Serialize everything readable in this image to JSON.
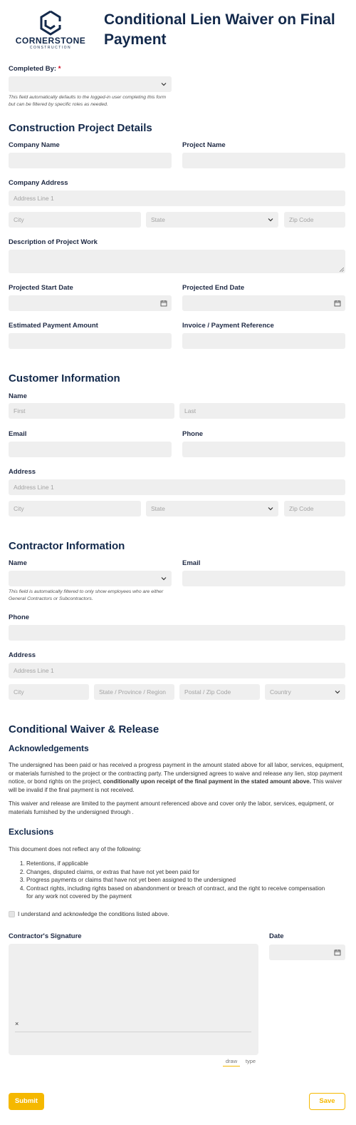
{
  "header": {
    "logo_name": "CORNERSTONE",
    "logo_sub": "CONSTRUCTION",
    "title_line1": "Conditional Lien Waiver on Final",
    "title_line2": "Payment"
  },
  "completed_by": {
    "label": "Completed By:",
    "required_mark": "*",
    "help": "This field automatically defaults to the logged-in user completing this form but can be filtered by specific roles as needed."
  },
  "project": {
    "heading": "Construction Project Details",
    "company_name_label": "Company Name",
    "project_name_label": "Project Name",
    "company_address_label": "Company Address",
    "address_line1_ph": "Address Line 1",
    "city_ph": "City",
    "state_ph": "State",
    "zip_ph": "Zip Code",
    "description_label": "Description of Project Work",
    "start_date_label": "Projected Start Date",
    "end_date_label": "Projected End Date",
    "payment_amount_label": "Estimated Payment Amount",
    "invoice_label": "Invoice / Payment Reference"
  },
  "customer": {
    "heading": "Customer Information",
    "name_label": "Name",
    "first_ph": "First",
    "last_ph": "Last",
    "email_label": "Email",
    "phone_label": "Phone",
    "address_label": "Address",
    "address_line1_ph": "Address Line 1",
    "city_ph": "City",
    "state_ph": "State",
    "zip_ph": "Zip Code"
  },
  "contractor": {
    "heading": "Contractor Information",
    "name_label": "Name",
    "email_label": "Email",
    "help": "This field is automatically filtered to only show employees who are either General Contractors or Subcontractors.",
    "phone_label": "Phone",
    "address_label": "Address",
    "address_line1_ph": "Address Line 1",
    "city_ph": "City",
    "state_ph": "State / Province / Region",
    "postal_ph": "Postal / Zip Code",
    "country_ph": "Country"
  },
  "waiver": {
    "heading": "Conditional Waiver & Release",
    "ack_heading": "Acknowledgements",
    "para1_a": "The undersigned has been paid or has received a progress payment in the amount stated above for all labor, services, equipment, or materials furnished to the project or the contracting party. The undersigned agrees to waive and release any lien, stop payment notice, or bond rights on the project, ",
    "para1_bold": "conditionally upon receipt of the final payment in the stated amount above.",
    "para1_b": " This waiver will be invalid if the final payment is not received.",
    "para2": "This waiver and release are limited to the payment amount referenced above and cover only the labor, services, equipment, or materials furnished by the undersigned through .",
    "exclusions_heading": "Exclusions",
    "exclusions_intro": "This document does not reflect any of the following:",
    "exclusions": [
      "Retentions, if applicable",
      "Changes, disputed claims, or extras that have not yet been paid for",
      "Progress payments or claims that have not yet been assigned to the undersigned",
      "Contract rights, including rights based on abandonment or breach of contract, and the right to receive compensation for any work not covered by the payment"
    ],
    "checkbox_label": "I understand and acknowledge the conditions listed above."
  },
  "signature": {
    "label": "Contractor's Signature",
    "date_label": "Date",
    "clear_mark": "×",
    "tab_draw": "draw",
    "tab_type": "type"
  },
  "actions": {
    "submit": "Submit",
    "save": "Save"
  },
  "colors": {
    "navy": "#13294b",
    "field_bg": "#efefef",
    "accent_yellow": "#f5b800",
    "required_red": "#d0021b"
  }
}
